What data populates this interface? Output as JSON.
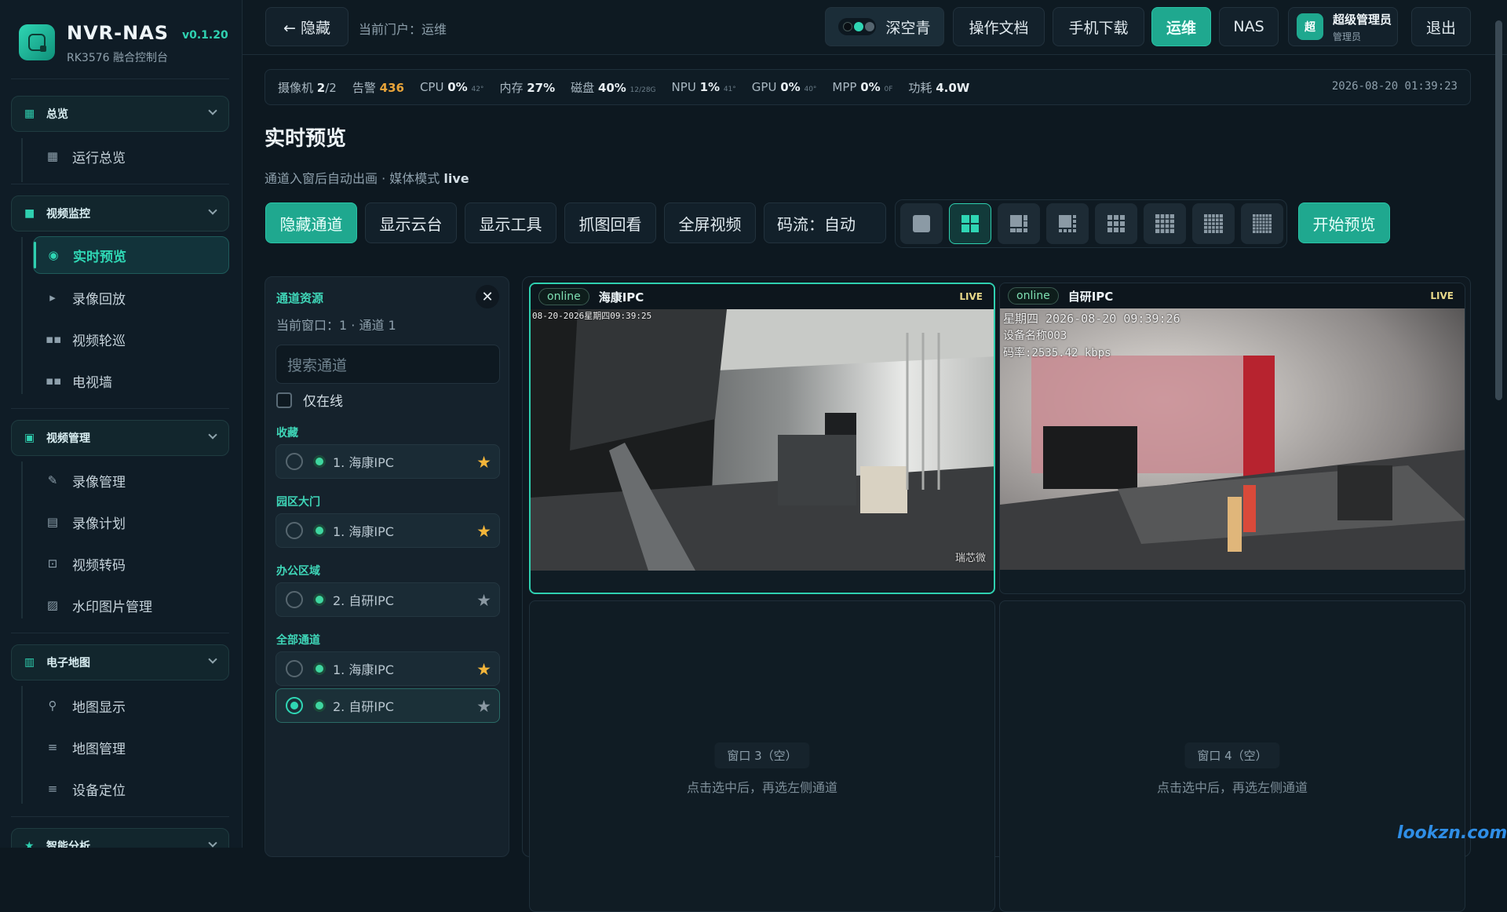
{
  "brand": {
    "name": "NVR-NAS",
    "version": "v0.1.20",
    "subtitle": "RK3576 融合控制台"
  },
  "sidebar": {
    "groups": [
      {
        "label": "总览",
        "icon": "dashboard-icon",
        "items": [
          {
            "label": "运行总览",
            "icon": "grid-icon"
          }
        ]
      },
      {
        "label": "视频监控",
        "icon": "camera-icon",
        "items": [
          {
            "label": "实时预览",
            "icon": "eye-icon",
            "active": true
          },
          {
            "label": "录像回放",
            "icon": "play-icon"
          },
          {
            "label": "视频轮巡",
            "icon": "grid-icon"
          },
          {
            "label": "电视墙",
            "icon": "grid-icon"
          }
        ]
      },
      {
        "label": "视频管理",
        "icon": "video-manage-icon",
        "items": [
          {
            "label": "录像管理",
            "icon": "file-edit-icon"
          },
          {
            "label": "录像计划",
            "icon": "document-icon"
          },
          {
            "label": "视频转码",
            "icon": "transcode-icon"
          },
          {
            "label": "水印图片管理",
            "icon": "image-icon"
          }
        ]
      },
      {
        "label": "电子地图",
        "icon": "map-icon",
        "items": [
          {
            "label": "地图显示",
            "icon": "pin-icon"
          },
          {
            "label": "地图管理",
            "icon": "list-icon"
          },
          {
            "label": "设备定位",
            "icon": "list-icon"
          }
        ]
      },
      {
        "label": "智能分析",
        "icon": "star-icon",
        "items": []
      }
    ]
  },
  "topbar": {
    "hide_label": "← 隐藏",
    "portal": "当前门户：运维",
    "theme_label": "深空青",
    "docs": "操作文档",
    "mobile": "手机下载",
    "ops": "运维",
    "nas": "NAS",
    "user": {
      "avatar": "超",
      "name": "超级管理员",
      "role": "管理员"
    },
    "logout": "退出"
  },
  "status": {
    "cameras_label": "摄像机",
    "cameras_value": "2",
    "cameras_total": "/2",
    "alarms_label": "告警",
    "alarms_value": "436",
    "cpu_label": "CPU",
    "cpu_value": "0%",
    "cpu_temp": "42°",
    "mem_label": "内存",
    "mem_value": "27%",
    "disk_label": "磁盘",
    "disk_value": "40%",
    "disk_detail": "12/28G",
    "npu_label": "NPU",
    "npu_value": "1%",
    "npu_temp": "41°",
    "gpu_label": "GPU",
    "gpu_value": "0%",
    "gpu_temp": "40°",
    "mpp_label": "MPP",
    "mpp_value": "0%",
    "mpp_detail": "0F",
    "power_label": "功耗",
    "power_value": "4.0W",
    "time": "2026-08-20 01:39:23"
  },
  "page": {
    "title": "实时预览",
    "subtitle_prefix": "通道入窗后自动出画 · 媒体模式",
    "media_mode": "live"
  },
  "controls": {
    "hide_channel": "隐藏通道",
    "show_ptz": "显示云台",
    "show_tools": "显示工具",
    "snapshot": "抓图回看",
    "fullscreen": "全屏视频",
    "stream": "码流：自动",
    "start": "开始预览"
  },
  "layouts": {
    "selected_index": 1,
    "options": [
      "1x1",
      "2x2",
      "1+5",
      "1+7",
      "3x3",
      "4x4",
      "5x5",
      "6x6"
    ]
  },
  "panel": {
    "title": "通道资源",
    "current": "当前窗口：1 · 通道 1",
    "search_placeholder": "搜索通道",
    "online_only": "仅在线",
    "sections": [
      {
        "title": "收藏",
        "channels": [
          {
            "name": "1. 海康IPC",
            "fav": true,
            "selected": false
          }
        ]
      },
      {
        "title": "园区大门",
        "channels": [
          {
            "name": "1. 海康IPC",
            "fav": true,
            "selected": false
          }
        ]
      },
      {
        "title": "办公区域",
        "channels": [
          {
            "name": "2. 自研IPC",
            "fav": false,
            "selected": false
          }
        ]
      },
      {
        "title": "全部通道",
        "channels": [
          {
            "name": "1. 海康IPC",
            "fav": true,
            "selected": false
          },
          {
            "name": "2. 自研IPC",
            "fav": false,
            "selected": true
          }
        ]
      }
    ]
  },
  "windows": [
    {
      "status": "online",
      "name": "海康IPC",
      "live": "LIVE",
      "osd_top": "08-20-2026星期四09:39:25",
      "osd_corner": "瑞芯微"
    },
    {
      "status": "online",
      "name": "自研IPC",
      "live": "LIVE",
      "osd_lines": [
        "星期四 2026-08-20 09:39:26",
        "设备名称003",
        "码率:2535.42 kbps"
      ]
    },
    {
      "empty_tag": "窗口 3（空）",
      "hint": "点击选中后，再选左侧通道"
    },
    {
      "empty_tag": "窗口 4（空）",
      "hint": "点击选中后，再选左侧通道"
    }
  ],
  "watermark": "lookzn.com"
}
